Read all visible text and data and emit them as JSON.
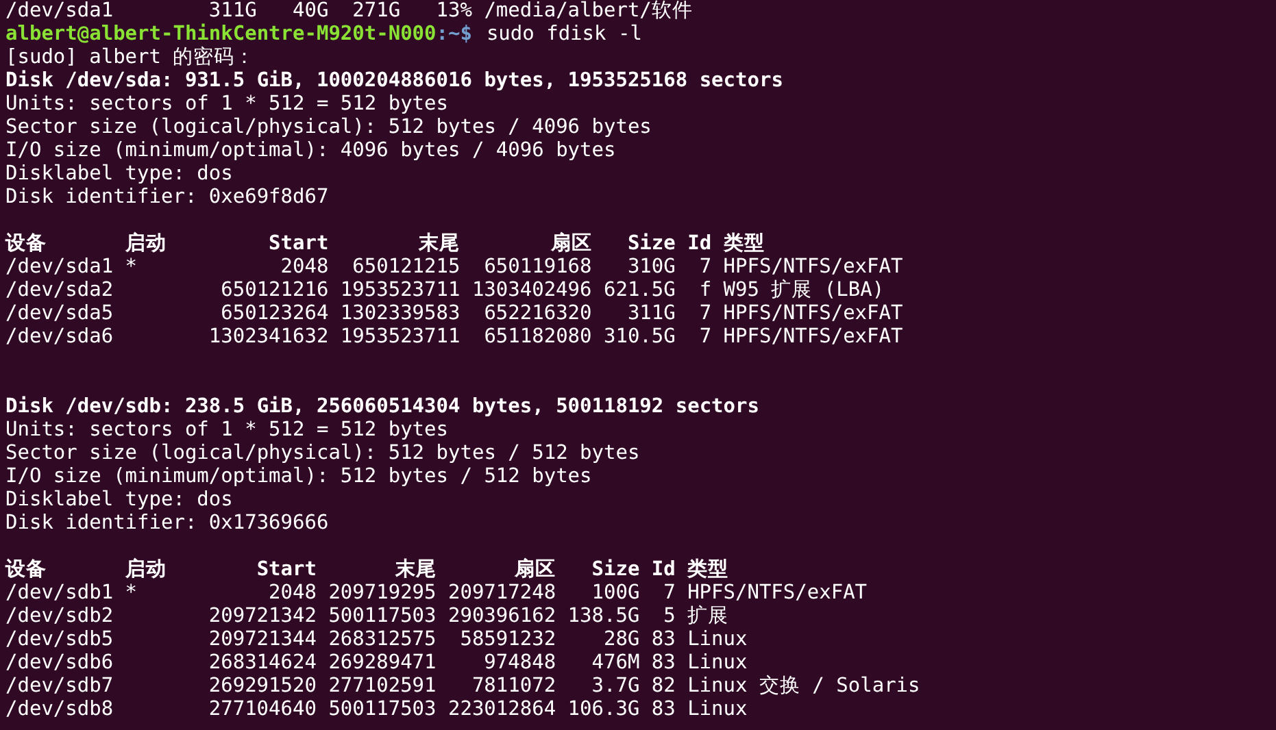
{
  "terminal": {
    "previous_output": "/dev/sda1        311G   40G  271G   13% /media/albert/软件",
    "prompt": {
      "user_host": "albert@albert-ThinkCentre-M920t-N000",
      "separator": ":",
      "path": "~",
      "symbol": "$",
      "command": "sudo fdisk -l"
    },
    "password_prompt": "[sudo] albert 的密码：",
    "disks": [
      {
        "summary": "Disk /dev/sda: 931.5 GiB, 1000204886016 bytes, 1953525168 sectors",
        "info": [
          "Units: sectors of 1 * 512 = 512 bytes",
          "Sector size (logical/physical): 512 bytes / 4096 bytes",
          "I/O size (minimum/optimal): 4096 bytes / 4096 bytes",
          "Disklabel type: dos",
          "Disk identifier: 0xe69f8d67"
        ],
        "columns": [
          "设备",
          "启动",
          "Start",
          "末尾",
          "扇区",
          "Size",
          "Id",
          "类型"
        ],
        "partitions": [
          {
            "cells": [
              "/dev/sda1",
              "*",
              "2048",
              "650121215",
              "650119168",
              "310G",
              "7",
              "HPFS/NTFS/exFAT"
            ]
          },
          {
            "cells": [
              "/dev/sda2",
              "",
              "650121216",
              "1953523711",
              "1303402496",
              "621.5G",
              "f",
              "W95 扩展 (LBA)"
            ]
          },
          {
            "cells": [
              "/dev/sda5",
              "",
              "650123264",
              "1302339583",
              "652216320",
              "311G",
              "7",
              "HPFS/NTFS/exFAT"
            ]
          },
          {
            "cells": [
              "/dev/sda6",
              "",
              "1302341632",
              "1953523711",
              "651182080",
              "310.5G",
              "7",
              "HPFS/NTFS/exFAT"
            ]
          }
        ]
      },
      {
        "summary": "Disk /dev/sdb: 238.5 GiB, 256060514304 bytes, 500118192 sectors",
        "info": [
          "Units: sectors of 1 * 512 = 512 bytes",
          "Sector size (logical/physical): 512 bytes / 512 bytes",
          "I/O size (minimum/optimal): 512 bytes / 512 bytes",
          "Disklabel type: dos",
          "Disk identifier: 0x17369666"
        ],
        "columns": [
          "设备",
          "启动",
          "Start",
          "末尾",
          "扇区",
          "Size",
          "Id",
          "类型"
        ],
        "partitions": [
          {
            "cells": [
              "/dev/sdb1",
              "*",
              "2048",
              "209719295",
              "209717248",
              "100G",
              "7",
              "HPFS/NTFS/exFAT"
            ]
          },
          {
            "cells": [
              "/dev/sdb2",
              "",
              "209721342",
              "500117503",
              "290396162",
              "138.5G",
              "5",
              "扩展"
            ]
          },
          {
            "cells": [
              "/dev/sdb5",
              "",
              "209721344",
              "268312575",
              "58591232",
              "28G",
              "83",
              "Linux"
            ]
          },
          {
            "cells": [
              "/dev/sdb6",
              "",
              "268314624",
              "269289471",
              "974848",
              "476M",
              "83",
              "Linux"
            ]
          },
          {
            "cells": [
              "/dev/sdb7",
              "",
              "269291520",
              "277102591",
              "7811072",
              "3.7G",
              "82",
              "Linux 交换 / Solaris"
            ]
          },
          {
            "cells": [
              "/dev/sdb8",
              "",
              "277104640",
              "500117503",
              "223012864",
              "106.3G",
              "83",
              "Linux"
            ]
          }
        ]
      }
    ]
  }
}
